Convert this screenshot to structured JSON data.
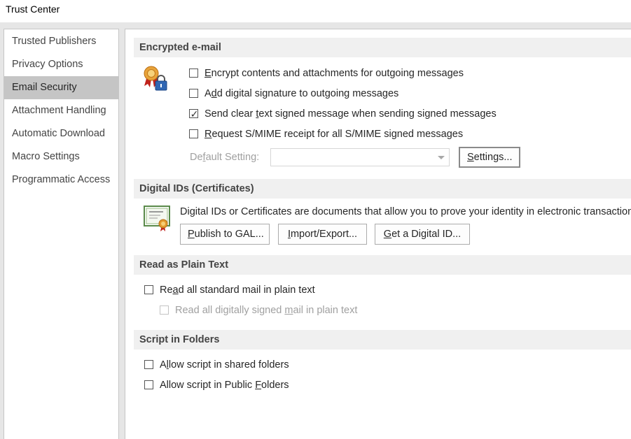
{
  "window": {
    "title": "Trust Center"
  },
  "sidebar": {
    "items": [
      {
        "label": "Trusted Publishers",
        "selected": false
      },
      {
        "label": "Privacy Options",
        "selected": false
      },
      {
        "label": "Email Security",
        "selected": true
      },
      {
        "label": "Attachment Handling",
        "selected": false
      },
      {
        "label": "Automatic Download",
        "selected": false
      },
      {
        "label": "Macro Settings",
        "selected": false
      },
      {
        "label": "Programmatic Access",
        "selected": false
      }
    ]
  },
  "encrypted": {
    "header": "Encrypted e-mail",
    "icon": "certificate-lock-icon",
    "options": [
      {
        "pre": "",
        "key": "E",
        "post": "ncrypt contents and attachments for outgoing messages",
        "checked": false
      },
      {
        "pre": "A",
        "key": "d",
        "post": "d digital signature to outgoing messages",
        "checked": false
      },
      {
        "pre": "Send clear ",
        "key": "t",
        "post": "ext signed message when sending signed messages",
        "checked": true
      },
      {
        "pre": "",
        "key": "R",
        "post": "equest S/MIME receipt for all S/MIME signed messages",
        "checked": false
      }
    ],
    "default_setting": {
      "pre": "De",
      "key": "f",
      "post": "ault Setting:",
      "value": ""
    },
    "settings_button": {
      "pre": "",
      "key": "S",
      "post": "ettings..."
    }
  },
  "digital_ids": {
    "header": "Digital IDs (Certificates)",
    "icon": "certificate-document-icon",
    "description": "Digital IDs or Certificates are documents that allow you to prove your identity in electronic transactions.",
    "buttons": [
      {
        "pre": "",
        "key": "P",
        "post": "ublish to GAL..."
      },
      {
        "pre": "",
        "key": "I",
        "post": "mport/Export..."
      },
      {
        "pre": "",
        "key": "G",
        "post": "et a Digital ID..."
      }
    ]
  },
  "plain_text": {
    "header": "Read as Plain Text",
    "options": [
      {
        "pre": "Re",
        "key": "a",
        "post": "d all standard mail in plain text",
        "checked": false,
        "disabled": false
      },
      {
        "pre": "Read all digitally signed ",
        "key": "m",
        "post": "ail in plain text",
        "checked": false,
        "disabled": true
      }
    ]
  },
  "script": {
    "header": "Script in Folders",
    "options": [
      {
        "pre": "A",
        "key": "l",
        "post": "low script in shared folders",
        "checked": false
      },
      {
        "pre": "Allow script in Public ",
        "key": "F",
        "post": "olders",
        "checked": false
      }
    ]
  },
  "colors": {
    "selected_nav": "#c5c5c5",
    "section_header": "#f0f0f0",
    "disabled_text": "#a0a0a0",
    "frame": "#e6e6e6"
  }
}
